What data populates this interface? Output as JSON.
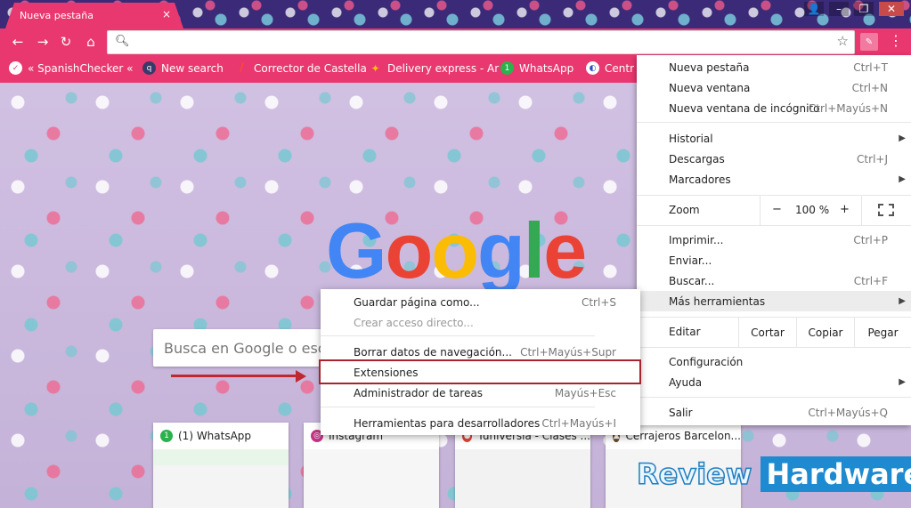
{
  "browser": {
    "tab_title": "Nueva pestaña",
    "tab_close": "×",
    "omnibox_value": ""
  },
  "bookmarks": [
    {
      "label": "« SpanishChecker « ",
      "icon": "check-icon",
      "color": "#e9386f"
    },
    {
      "label": "New search",
      "icon": "q-icon",
      "color": "#4a4a8a"
    },
    {
      "label": "Corrector de Castella",
      "icon": "pen-icon",
      "color": "#f04020"
    },
    {
      "label": "Delivery express - Ar",
      "icon": "delivery-icon",
      "color": "#ffb000"
    },
    {
      "label": "WhatsApp",
      "icon": "whatsapp-icon",
      "color": "#2bb24c"
    },
    {
      "label": "Centr",
      "icon": "globe-icon",
      "color": "#3050c0"
    }
  ],
  "google": {
    "logo": [
      "G",
      "o",
      "o",
      "g",
      "l",
      "e"
    ],
    "logo_colors": [
      "#4285f4",
      "#ea4335",
      "#fbbc05",
      "#4285f4",
      "#34a853",
      "#ea4335"
    ],
    "search_placeholder": "Busca en Google o escri"
  },
  "tiles": [
    {
      "title": "(1) WhatsApp",
      "icon": "whatsapp-icon",
      "color": "#2bb24c"
    },
    {
      "title": "Instagram",
      "icon": "instagram-icon",
      "color": "#c13584"
    },
    {
      "title": "Tuniversia - Clases ...",
      "icon": "chrome-icon",
      "color": "#db4437"
    },
    {
      "title": "Cerrajeros Barcelon...",
      "icon": "lock-icon",
      "color": "#6a4a2a"
    }
  ],
  "menu": {
    "items": [
      {
        "label": "Nueva pestaña",
        "shortcut": "Ctrl+T"
      },
      {
        "label": "Nueva ventana",
        "shortcut": "Ctrl+N"
      },
      {
        "label": "Nueva ventana de incógnito",
        "shortcut": "Ctrl+Mayús+N"
      },
      {
        "label": "Historial",
        "shortcut": "",
        "submenu": true
      },
      {
        "label": "Descargas",
        "shortcut": "Ctrl+J"
      },
      {
        "label": "Marcadores",
        "shortcut": "",
        "submenu": true
      },
      {
        "label": "Imprimir...",
        "shortcut": "Ctrl+P"
      },
      {
        "label": "Enviar...",
        "shortcut": ""
      },
      {
        "label": "Buscar...",
        "shortcut": "Ctrl+F"
      },
      {
        "label": "Más herramientas",
        "shortcut": "",
        "submenu": true
      },
      {
        "label": "Configuración",
        "shortcut": ""
      },
      {
        "label": "Ayuda",
        "shortcut": "",
        "submenu": true
      },
      {
        "label": "Salir",
        "shortcut": "Ctrl+Mayús+Q"
      }
    ],
    "zoom": {
      "label": "Zoom",
      "minus": "−",
      "value": "100 %",
      "plus": "+"
    },
    "edit": {
      "label": "Editar",
      "cut": "Cortar",
      "copy": "Copiar",
      "paste": "Pegar"
    }
  },
  "submenu": {
    "items": [
      {
        "label": "Guardar página como...",
        "shortcut": "Ctrl+S"
      },
      {
        "label": "Crear acceso directo...",
        "shortcut": "",
        "disabled": true
      },
      {
        "label": "Borrar datos de navegación...",
        "shortcut": "Ctrl+Mayús+Supr"
      },
      {
        "label": "Extensiones",
        "shortcut": ""
      },
      {
        "label": "Administrador de tareas",
        "shortcut": "Mayús+Esc"
      },
      {
        "label": "Herramientas para desarrolladores",
        "shortcut": "Ctrl+Mayús+I"
      }
    ]
  },
  "watermark": {
    "part1": "Review",
    "part2": "Hardware"
  },
  "colors": {
    "accent": "#e9386f",
    "highlight_border": "#a8242c"
  }
}
